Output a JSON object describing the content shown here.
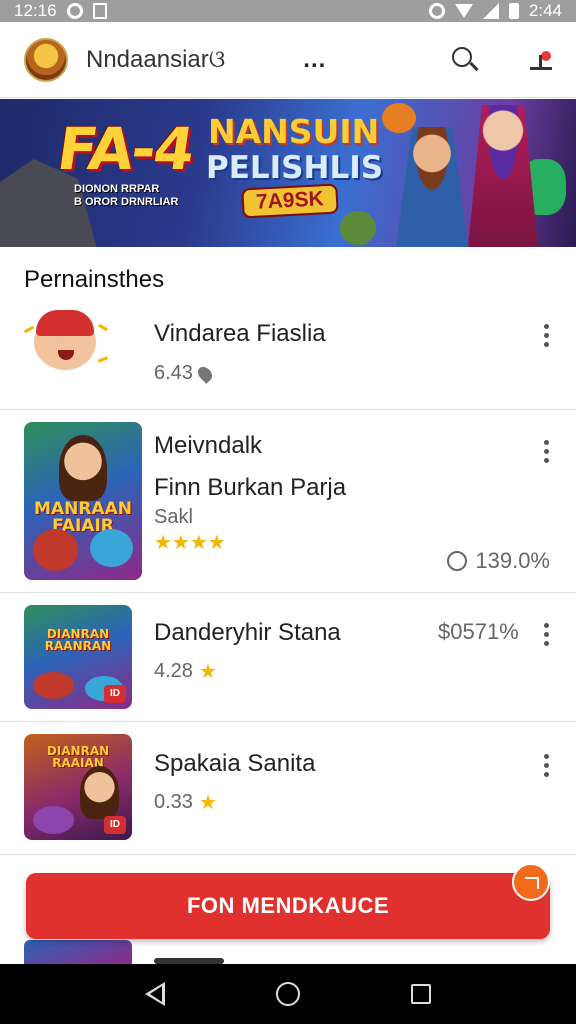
{
  "status_bar": {
    "time": "12:16",
    "right_text": "2:44"
  },
  "app_bar": {
    "title": "Nndaansiarଓ",
    "more_label": "..."
  },
  "banner": {
    "title_left": "FA-4",
    "subtitle_small": "DIONON RRPAR",
    "subtitle_small2": "B OROR DRNRLIAR",
    "title_right_line1": "NANSUIN",
    "title_right_line2": "PELISHLIS",
    "badge": "7A9SK"
  },
  "section": {
    "title": "Pernainsthes"
  },
  "items": [
    {
      "name": "Vindarea Fiaslia",
      "rating": "6.43"
    },
    {
      "name": "Meivndalk",
      "subtitle": "Finn Burkan Parja",
      "meta": "Sakl",
      "thumb_logo": "MANRAAN FAIAIR",
      "extra_value": "139.0%"
    },
    {
      "name": "Danderyhir Stana",
      "rating": "4.28",
      "price": "$0571%",
      "thumb_logo": "DIANRAN RAANRAN"
    },
    {
      "name": "Spakaia Sanita",
      "rating": "0.33",
      "thumb_logo": "DIANRAN RAAIAN"
    }
  ],
  "cta": {
    "label": "FON MENDKAUCE"
  },
  "colors": {
    "accent": "#e0312f",
    "star": "#f5b400",
    "navbar": "#000000",
    "statusbar": "#9e9e9e"
  },
  "icons": {
    "search": "search-icon",
    "notify": "notification-icon",
    "more": "more-vert-icon",
    "back": "back-icon",
    "home": "home-icon",
    "recents": "recents-icon"
  }
}
